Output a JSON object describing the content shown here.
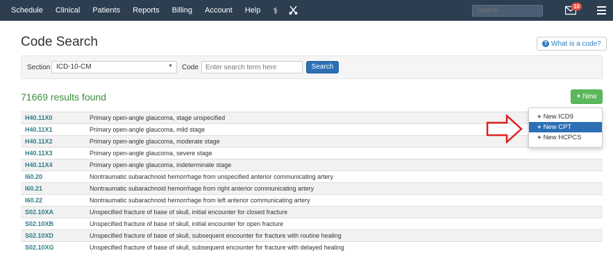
{
  "nav": {
    "items": [
      "Schedule",
      "Clinical",
      "Patients",
      "Reports",
      "Billing",
      "Account",
      "Help"
    ],
    "icons": [
      "caduceus-icon",
      "scissors-icon"
    ],
    "search_placeholder": "Search",
    "mail_count": "10"
  },
  "page": {
    "title": "Code Search",
    "help_label": "What is a code?"
  },
  "search": {
    "section_label": "Section",
    "section_value": "ICD-10-CM",
    "code_label": "Code",
    "code_placeholder": "Enter search term here",
    "button_label": "Search"
  },
  "results": {
    "count_text": "71669 results found",
    "new_button_label": "New",
    "rows": [
      {
        "code": "H40.11X0",
        "description": "Primary open-angle glaucoma, stage unspecified"
      },
      {
        "code": "H40.11X1",
        "description": "Primary open-angle glaucoma, mild stage"
      },
      {
        "code": "H40.11X2",
        "description": "Primary open-angle glaucoma, moderate stage"
      },
      {
        "code": "H40.11X3",
        "description": "Primary open-angle glaucoma, severe stage"
      },
      {
        "code": "H40.11X4",
        "description": "Primary open-angle glaucoma, indeterminate stage"
      },
      {
        "code": "I60.20",
        "description": "Nontraumatic subarachnoid hemorrhage from unspecified anterior communicating artery"
      },
      {
        "code": "I60.21",
        "description": "Nontraumatic subarachnoid hemorrhage from right anterior communicating artery"
      },
      {
        "code": "I60.22",
        "description": "Nontraumatic subarachnoid hemorrhage from left anterior communicating artery"
      },
      {
        "code": "S02.10XA",
        "description": "Unspecified fracture of base of skull, initial encounter for closed fracture"
      },
      {
        "code": "S02.10XB",
        "description": "Unspecified fracture of base of skull, initial encounter for open fracture"
      },
      {
        "code": "S02.10XD",
        "description": "Unspecified fracture of base of skull, subsequent encounter for fracture with routine healing"
      },
      {
        "code": "S02.10XG",
        "description": "Unspecified fracture of base of skull, subsequent encounter for fracture with delayed healing"
      }
    ]
  },
  "dropdown": {
    "items": [
      "New ICD9",
      "New CPT",
      "New HCPCS"
    ],
    "active_index": 1
  },
  "colors": {
    "navbar": "#2c3e50",
    "primary": "#2c6fb5",
    "success": "#5cb85c",
    "code_text": "#2e7d87",
    "results_text": "#3c8c3c",
    "arrow": "#e02020",
    "badge": "#e74c3c"
  }
}
